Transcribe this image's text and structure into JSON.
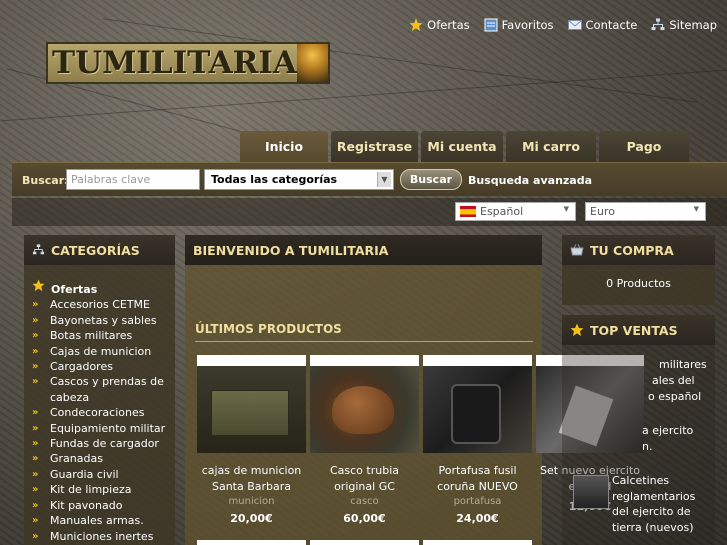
{
  "top_links": [
    {
      "label": "Ofertas",
      "icon": "star-icon"
    },
    {
      "label": "Favoritos",
      "icon": "bookmark-icon"
    },
    {
      "label": "Contacte",
      "icon": "envelope-icon"
    },
    {
      "label": "Sitemap",
      "icon": "sitemap-icon"
    }
  ],
  "logo_text": "TUMILITARIA",
  "nav_tabs": [
    "Inicio",
    "Registrase",
    "Mi cuenta",
    "Mi carro",
    "Pago"
  ],
  "search": {
    "label": "Buscar:",
    "placeholder": "Palabras clave",
    "category_selected": "Todas las categorías",
    "button": "Buscar",
    "advanced": "Busqueda avanzada"
  },
  "language": "Español",
  "currency": "Euro",
  "categories": {
    "title": "CATEGORÍAS",
    "featured": "Ofertas",
    "items": [
      "Accesorios CETME",
      "Bayonetas y sables",
      "Botas militares",
      "Cajas de municion",
      "Cargadores",
      "Cascos y prendas de cabeza",
      "Condecoraciones",
      "Equipamiento militar",
      "Fundas de cargador",
      "Granadas",
      "Guardia civil",
      "Kit de limpieza",
      "Kit pavonado",
      "Manuales armas.",
      "Municiones inertes"
    ]
  },
  "welcome_title": "BIENVENIDO A TUMILITARIA",
  "latest_title": "ÚLTIMOS PRODUCTOS",
  "products": [
    {
      "name": "cajas de municion Santa Barbara",
      "category": "municion",
      "price": "20,00€"
    },
    {
      "name": "Casco trubia original GC",
      "category": "casco",
      "price": "60,00€"
    },
    {
      "name": "Portafusa fusil coruña NUEVO",
      "category": "portafusa",
      "price": "24,00€"
    },
    {
      "name": "Set nuevo ejercito español",
      "category": "",
      "price": "11,00€"
    }
  ],
  "cart": {
    "title": "TU COMPRA",
    "count_text": "0 Productos"
  },
  "top_sales": {
    "title": "TOP VENTAS",
    "fragment_lines": [
      "militares",
      "ales del",
      "o español",
      "",
      "a ejercito",
      "n."
    ],
    "item2": "Calcetines reglamentarios del ejercito de tierra (nuevos)"
  },
  "colors": {
    "accent": "#f2c01a",
    "heading": "#f0dfa0",
    "panel": "#3e3726"
  }
}
